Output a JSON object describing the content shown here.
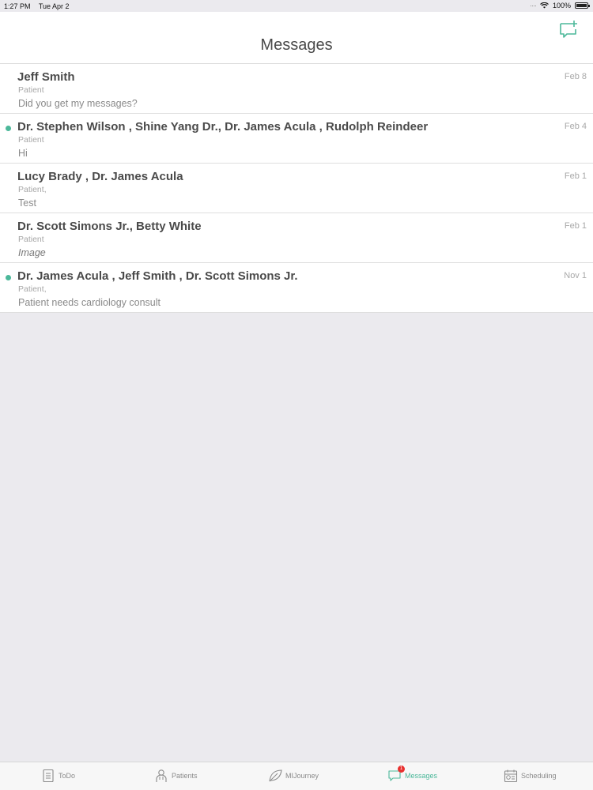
{
  "status_bar": {
    "time": "1:27 PM",
    "date": "Tue Apr 2",
    "battery": "100%"
  },
  "header": {
    "title": "Messages",
    "compose_icon": "compose-message-icon"
  },
  "conversations": [
    {
      "names": "Jeff Smith",
      "role": "Patient",
      "preview": "Did you get my messages?",
      "date": "Feb 8",
      "unread": false,
      "italic": false
    },
    {
      "names": "Dr. Stephen Wilson , Shine Yang Dr., Dr. James Acula , Rudolph Reindeer",
      "role": "Patient",
      "preview": "Hi",
      "date": "Feb 4",
      "unread": true,
      "italic": false
    },
    {
      "names": "Lucy Brady , Dr. James Acula",
      "role": "Patient,",
      "preview": "Test",
      "date": "Feb 1",
      "unread": false,
      "italic": false
    },
    {
      "names": "Dr. Scott Simons Jr., Betty White",
      "role": "Patient",
      "preview": "Image",
      "date": "Feb 1",
      "unread": false,
      "italic": true
    },
    {
      "names": "Dr. James Acula , Jeff Smith , Dr. Scott Simons Jr.",
      "role": "Patient,",
      "preview": "Patient needs cardiology consult",
      "date": "Nov 1",
      "unread": true,
      "italic": false
    }
  ],
  "tabbar": {
    "todo": "ToDo",
    "patients": "Patients",
    "mijourney": "MIJourney",
    "messages": "Messages",
    "messages_badge": "1",
    "scheduling": "Scheduling"
  },
  "colors": {
    "accent": "#4cb89a",
    "badge": "#e8302e",
    "background": "#ebeaee"
  }
}
